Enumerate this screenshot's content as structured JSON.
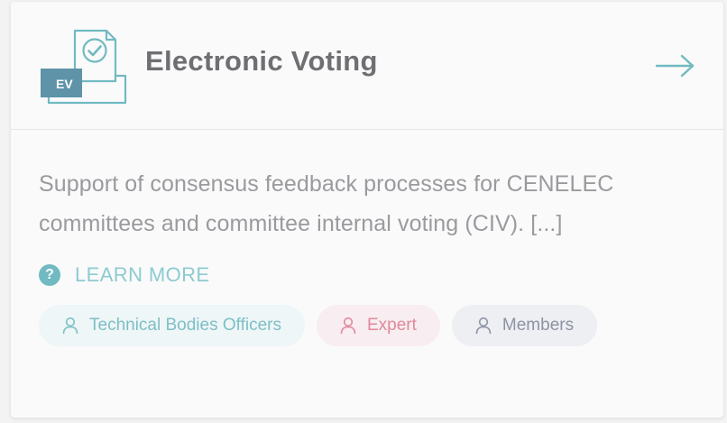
{
  "card": {
    "title": "Electronic Voting",
    "icon_badge": "EV",
    "icon": "ballot-box-check-icon",
    "arrow_icon": "arrow-right-icon",
    "description": "Support of consensus feedback processes for CENELEC committees and committee internal voting (CIV). [...]",
    "learn_more": "LEARN MORE",
    "help_icon_glyph": "?",
    "tags": [
      {
        "label": "Technical Bodies Officers",
        "icon": "user-icon",
        "color": "#7ebfc6"
      },
      {
        "label": "Expert",
        "icon": "user-icon",
        "color": "#e0899e"
      },
      {
        "label": "Members",
        "icon": "user-icon",
        "color": "#8d93a2"
      }
    ]
  },
  "colors": {
    "accent": "#71bac2",
    "title": "#6f6f73",
    "body_text": "#9a9a9f",
    "badge_bg": "#5e93a8"
  }
}
